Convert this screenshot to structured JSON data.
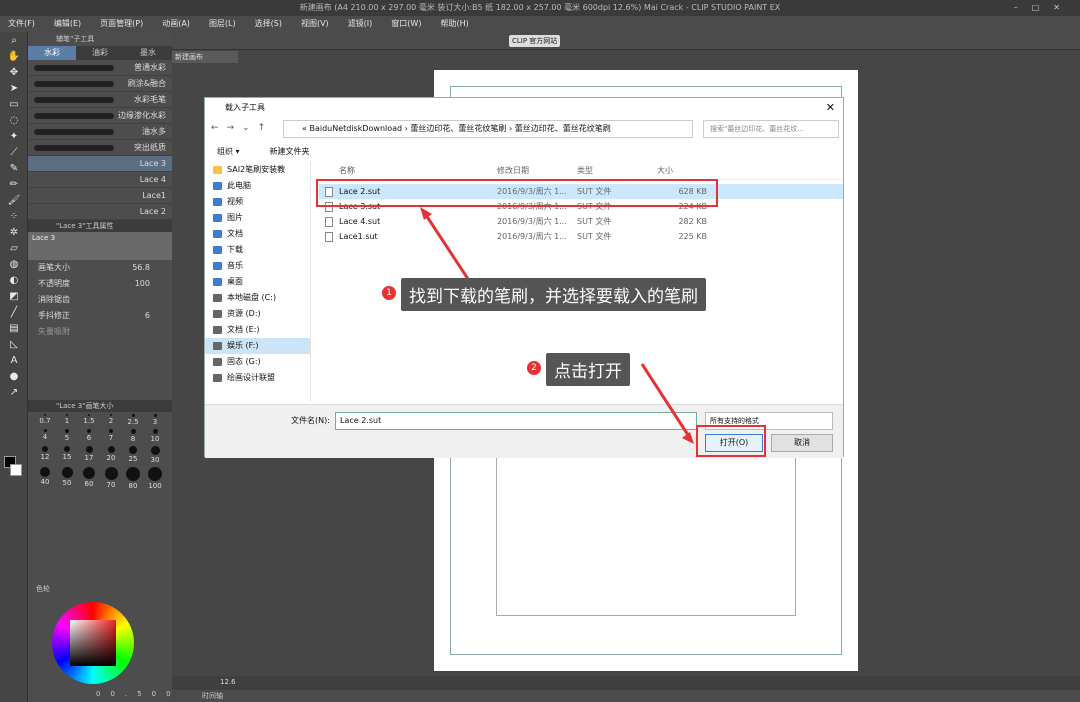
{
  "app": {
    "title": "新建画布 (A4 210.00 x 297.00 毫米 装订大小:B5 纸 182.00 x 257.00 毫米 600dpi 12.6%)  Mai Crack - CLIP STUDIO PAINT EX"
  },
  "menu": [
    "文件(F)",
    "编辑(E)",
    "页面管理(P)",
    "动画(A)",
    "图层(L)",
    "选择(S)",
    "视图(V)",
    "滤镜(I)",
    "窗口(W)",
    "帮助(H)"
  ],
  "toolbar": {
    "clip_label": "CLIP 官方网站"
  },
  "canvas_tab": "新建画布",
  "subtool": {
    "header": "辅笔\"子工具",
    "tabs": [
      "水彩",
      "油彩",
      "墨水"
    ],
    "brushes": [
      "普通水彩",
      "刷涂&融合",
      "水彩毛笔",
      "边缘渗化水彩",
      "油水多",
      "突出纸质",
      "Lace 3",
      "Lace 4",
      "Lace1",
      "Lace 2"
    ],
    "tool_property_title": "\"Lace 3\"工具属性",
    "preview_name": "Lace 3",
    "props": [
      {
        "label": "画笔大小",
        "value": "56.8"
      },
      {
        "label": "不透明度",
        "value": "100"
      },
      {
        "label": "消除锯齿",
        "value": ""
      },
      {
        "label": "手抖修正",
        "value": "6"
      },
      {
        "label": "矢量吸附",
        "value": ""
      }
    ],
    "size_title": "\"Lace 3\"画笔大小",
    "sizes": [
      "0.7",
      "1",
      "1.5",
      "2",
      "2.5",
      "3",
      "4",
      "5",
      "6",
      "7",
      "8",
      "10",
      "12",
      "15",
      "17",
      "20",
      "25",
      "30",
      "40",
      "50",
      "60",
      "70",
      "80",
      "100"
    ]
  },
  "color": {
    "tab_label": "色轮",
    "values": [
      "0",
      "0.5",
      "0",
      "0"
    ]
  },
  "bottom": {
    "zoom": "12.6",
    "layer_tab": "时间轴"
  },
  "dialog": {
    "title": "载入子工具",
    "path": [
      "«",
      "BaiduNetdiskDownload",
      "›",
      "蕾丝边印花、蕾丝花纹笔刷",
      "›",
      "蕾丝边印花、蕾丝花纹笔刷"
    ],
    "search_placeholder": "搜索\"蕾丝边印花、蕾丝花纹...",
    "commands": [
      "组织 ▾",
      "新建文件夹"
    ],
    "nav": [
      "SAI2笔刷安装教",
      "此电脑",
      "视频",
      "图片",
      "文档",
      "下载",
      "音乐",
      "桌面",
      "本地磁盘 (C:)",
      "资源 (D:)",
      "文档 (E:)",
      "娱乐 (F:)",
      "固态 (G:)",
      "绘画设计联盟"
    ],
    "columns": [
      "名称",
      "修改日期",
      "类型",
      "大小"
    ],
    "files": [
      {
        "name": "Lace 2.sut",
        "date": "2016/9/3/周六 1...",
        "type": "SUT 文件",
        "size": "628 KB"
      },
      {
        "name": "Lace 3.sut",
        "date": "2016/9/3/周六 1...",
        "type": "SUT 文件",
        "size": "224 KB"
      },
      {
        "name": "Lace 4.sut",
        "date": "2016/9/3/周六 1...",
        "type": "SUT 文件",
        "size": "282 KB"
      },
      {
        "name": "Lace1.sut",
        "date": "2016/9/3/周六 1...",
        "type": "SUT 文件",
        "size": "225 KB"
      }
    ],
    "filename_label": "文件名(N):",
    "filename_value": "Lace 2.sut",
    "filetype_value": "所有支持的格式",
    "open_label": "打开(O)",
    "cancel_label": "取消"
  },
  "annotations": [
    {
      "number": "1",
      "text": "找到下载的笔刷，并选择要载入的笔刷"
    },
    {
      "number": "2",
      "text": "点击打开"
    }
  ],
  "colors": {
    "accent": "#e63232",
    "selection": "#cce8ff"
  }
}
